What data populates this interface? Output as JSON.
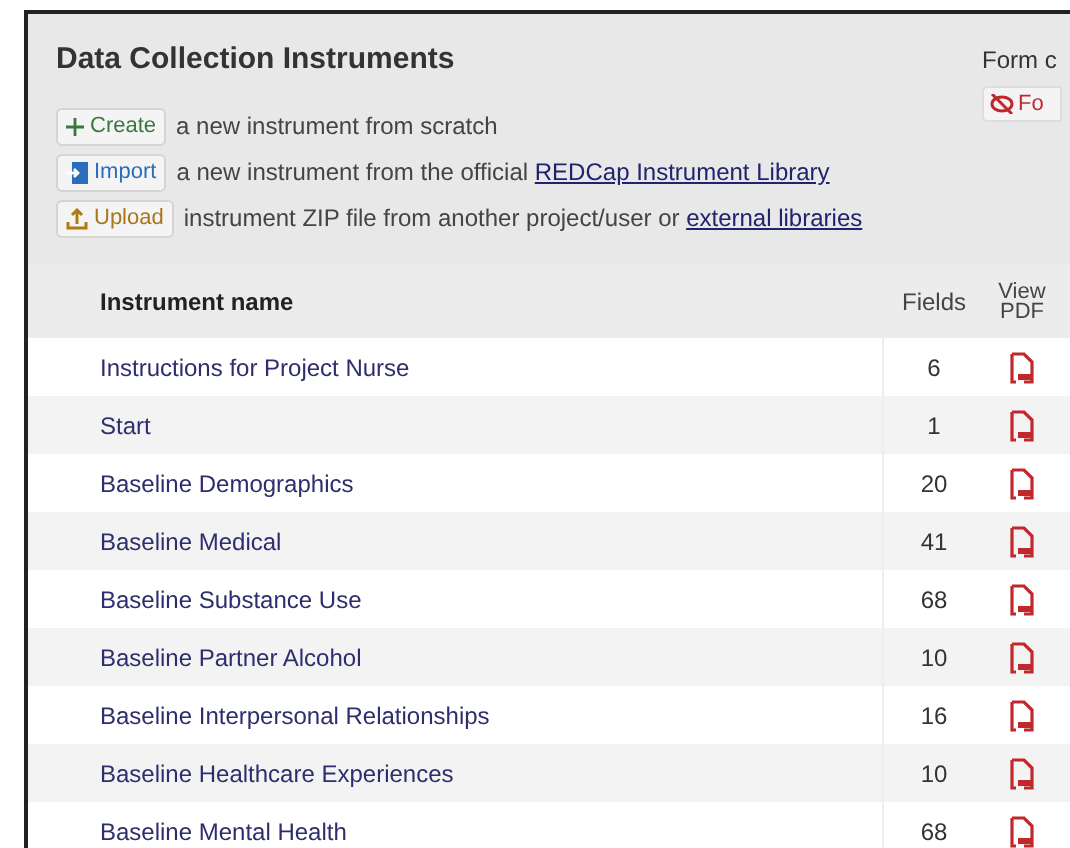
{
  "panel": {
    "title": "Data Collection Instruments",
    "side_label": "Form c",
    "side_button": "Fo",
    "actions": [
      {
        "kind": "create",
        "button": "Create",
        "text": "a new instrument from scratch"
      },
      {
        "kind": "import",
        "button": "Import",
        "text": "a new instrument from the official ",
        "link": "REDCap Instrument Library"
      },
      {
        "kind": "upload",
        "button": "Upload",
        "text": "instrument ZIP file from another project/user or ",
        "link": "external libraries"
      }
    ]
  },
  "table": {
    "columns": [
      "Instrument name",
      "Fields",
      "View PDF"
    ],
    "rows": [
      {
        "name": "Instructions for Project Nurse",
        "fields": "6"
      },
      {
        "name": "Start",
        "fields": "1"
      },
      {
        "name": "Baseline Demographics",
        "fields": "20"
      },
      {
        "name": "Baseline Medical",
        "fields": "41"
      },
      {
        "name": "Baseline Substance Use",
        "fields": "68"
      },
      {
        "name": "Baseline Partner Alcohol",
        "fields": "10"
      },
      {
        "name": "Baseline Interpersonal Relationships",
        "fields": "16"
      },
      {
        "name": "Baseline Healthcare Experiences",
        "fields": "10"
      },
      {
        "name": "Baseline Mental Health",
        "fields": "68"
      }
    ]
  }
}
